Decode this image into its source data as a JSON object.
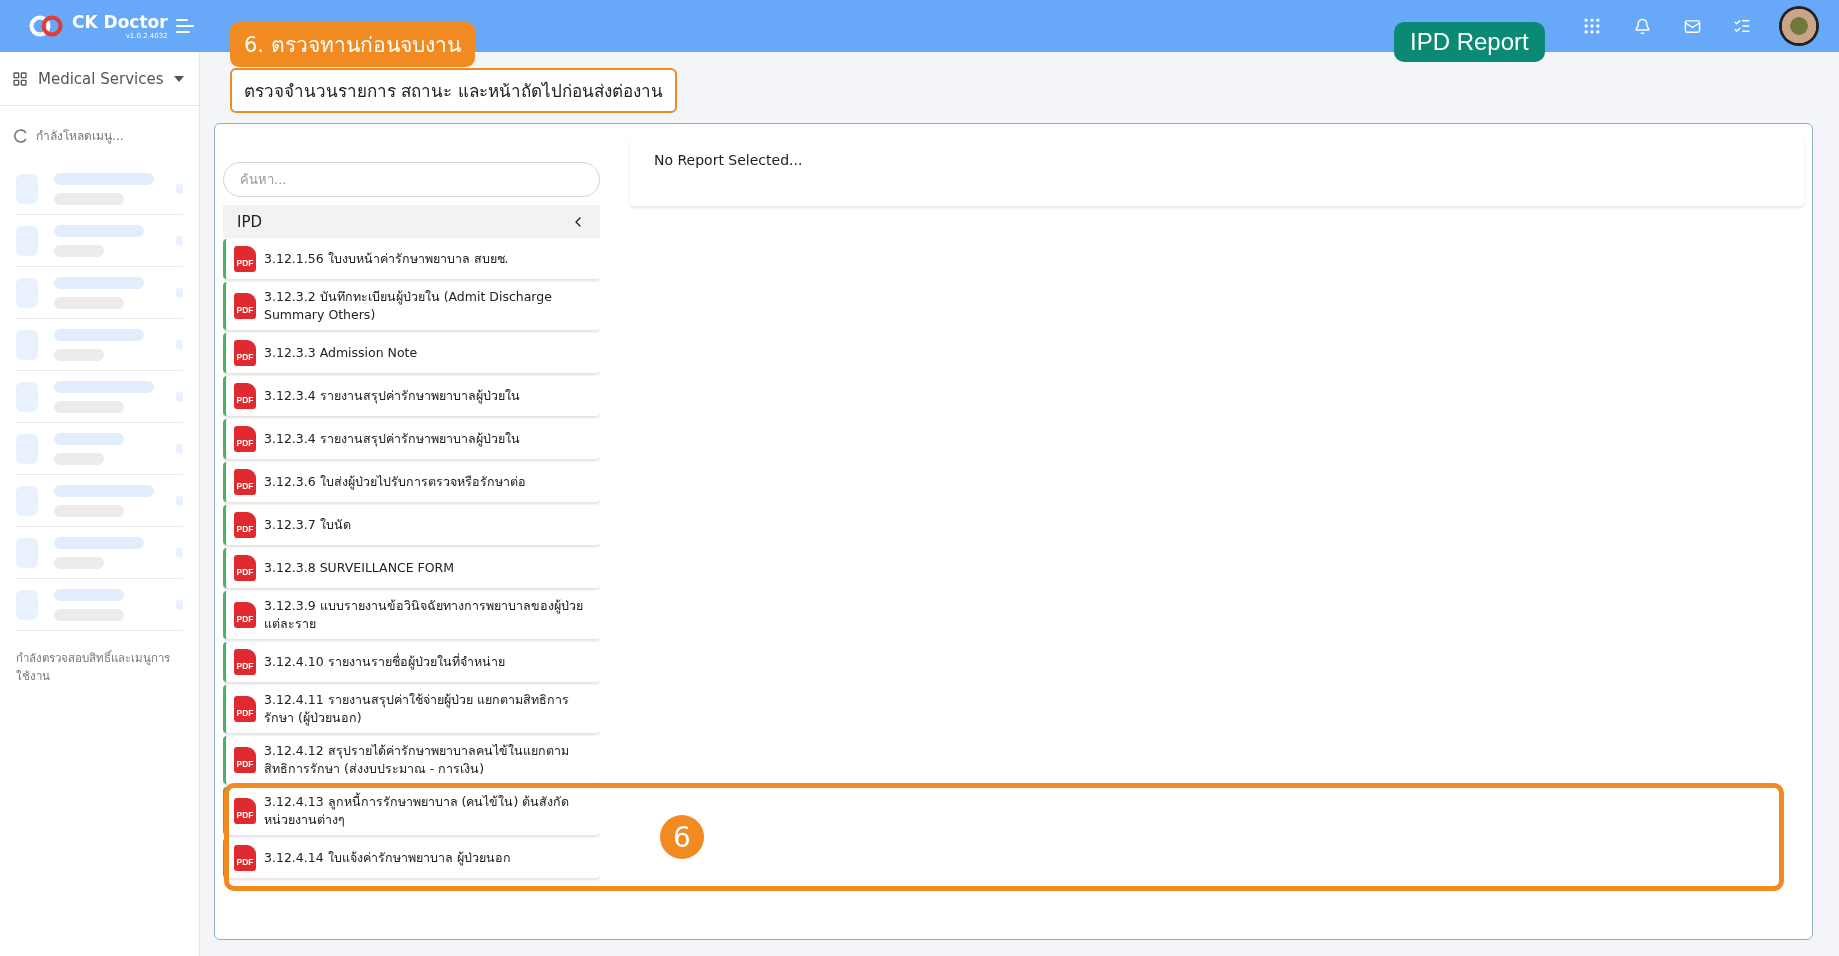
{
  "header": {
    "brand": "CK Doctor",
    "version": "v1.0.2.4032"
  },
  "sidebar": {
    "module": "Medical Services",
    "loading": "กำลังโหลดเมนู...",
    "status": "กำลังตรวจสอบสิทธิ์และเมนูการใช้งาน"
  },
  "report_list": {
    "search": {
      "placeholder": "ค้นหา..."
    },
    "group": {
      "label": "IPD"
    },
    "items": [
      {
        "title": "3.12.1.56 ใบงบหน้าค่ารักษาพยาบาล สบยช.",
        "file_type": "PDF"
      },
      {
        "title": "3.12.3.2 บันทึกทะเบียนผู้ป่วยใน (Admit Discharge Summary Others)",
        "file_type": "PDF"
      },
      {
        "title": "3.12.3.3 Admission Note",
        "file_type": "PDF"
      },
      {
        "title": "3.12.3.4 รายงานสรุปค่ารักษาพยาบาลผู้ป่วยใน",
        "file_type": "PDF"
      },
      {
        "title": "3.12.3.4 รายงานสรุปค่ารักษาพยาบาลผู้ป่วยใน",
        "file_type": "PDF"
      },
      {
        "title": "3.12.3.6 ใบส่งผู้ป่วยไปรับการตรวจหรือรักษาต่อ",
        "file_type": "PDF"
      },
      {
        "title": "3.12.3.7 ใบนัด",
        "file_type": "PDF"
      },
      {
        "title": "3.12.3.8 SURVEILLANCE FORM",
        "file_type": "PDF"
      },
      {
        "title": "3.12.3.9 แบบรายงานข้อวินิจฉัยทางการพยาบาลของผู้ป่วยแต่ละราย",
        "file_type": "PDF"
      },
      {
        "title": "3.12.4.10 รายงานรายชื่อผู้ป่วยในที่จำหน่าย",
        "file_type": "PDF"
      },
      {
        "title": "3.12.4.11 รายงานสรุปค่าใช้จ่ายผู้ป่วย แยกตามสิทธิการรักษา (ผู้ป่วยนอก)",
        "file_type": "PDF"
      },
      {
        "title": "3.12.4.12 สรุปรายได้ค่ารักษาพยาบาลคนไข้ในแยกตามสิทธิการรักษา (ส่งงบประมาณ - การเงิน)",
        "file_type": "PDF"
      },
      {
        "title": "3.12.4.13 ลูกหนี้การรักษาพยาบาล (คนไข้ใน) ต้นสังกัดหน่วยงานต่างๆ",
        "file_type": "PDF"
      },
      {
        "title": "3.12.4.14 ใบแจ้งค่ารักษาพยาบาล ผู้ป่วยนอก",
        "file_type": "PDF"
      }
    ]
  },
  "preview": {
    "message": "No Report Selected..."
  },
  "annotations": {
    "step": "6. ตรวจทานก่อนจบงาน",
    "note": "ตรวจจำนวนรายการ สถานะ และหน้าถัดไปก่อนส่งต่องาน",
    "badge": "IPD Report",
    "marker": "6"
  }
}
